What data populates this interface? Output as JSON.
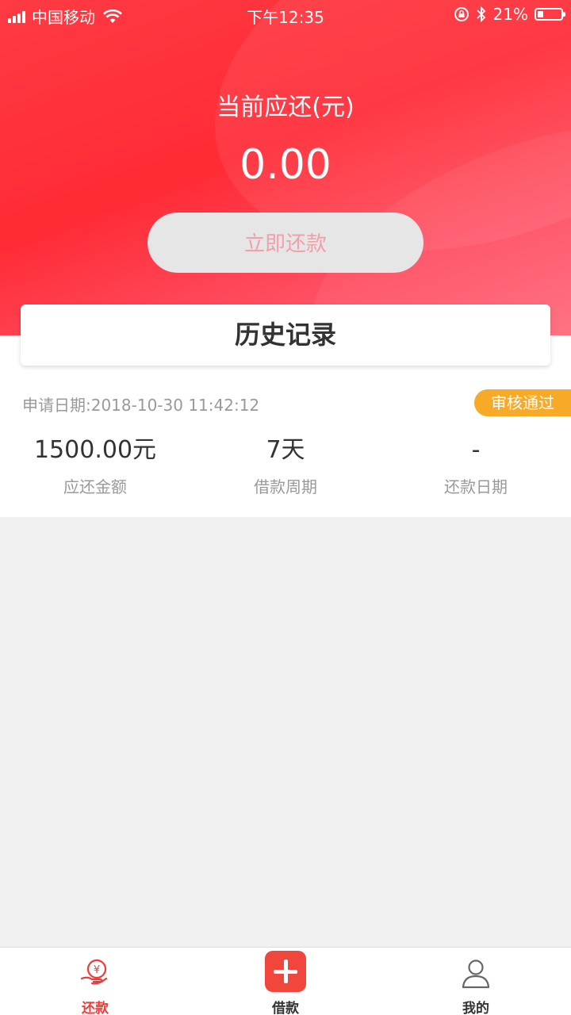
{
  "status_bar": {
    "carrier": "中国移动",
    "time": "下午12:35",
    "battery_percent": "21%"
  },
  "summary": {
    "due_label": "当前应还(元)",
    "due_amount": "0.00",
    "repay_button_label": "立即还款"
  },
  "history": {
    "title": "历史记录",
    "records": [
      {
        "apply_date": "申请日期:2018-10-30 11:42:12",
        "status": "审核通过",
        "amount_value": "1500.00元",
        "amount_label": "应还金额",
        "period_value": "7天",
        "period_label": "借款周期",
        "repay_date_value": "-",
        "repay_date_label": "还款日期"
      }
    ]
  },
  "tabbar": {
    "items": [
      {
        "label": "还款",
        "icon": "repay-yen-icon",
        "active": true
      },
      {
        "label": "借款",
        "icon": "plus-icon",
        "active": false
      },
      {
        "label": "我的",
        "icon": "user-icon",
        "active": false
      }
    ]
  },
  "colors": {
    "primary_red": "#ff2b35",
    "badge_orange": "#f7a928",
    "active_tab": "#f03a3a"
  }
}
